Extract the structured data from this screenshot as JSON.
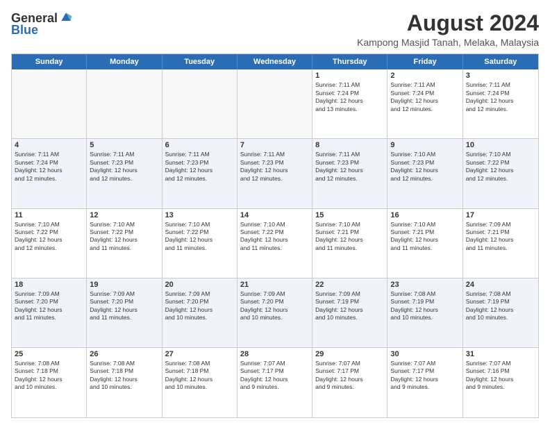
{
  "header": {
    "logo_general": "General",
    "logo_blue": "Blue",
    "month_year": "August 2024",
    "location": "Kampong Masjid Tanah, Melaka, Malaysia"
  },
  "days_of_week": [
    "Sunday",
    "Monday",
    "Tuesday",
    "Wednesday",
    "Thursday",
    "Friday",
    "Saturday"
  ],
  "weeks": [
    {
      "alt": false,
      "cells": [
        {
          "day": "",
          "info": ""
        },
        {
          "day": "",
          "info": ""
        },
        {
          "day": "",
          "info": ""
        },
        {
          "day": "",
          "info": ""
        },
        {
          "day": "1",
          "info": "Sunrise: 7:11 AM\nSunset: 7:24 PM\nDaylight: 12 hours\nand 13 minutes."
        },
        {
          "day": "2",
          "info": "Sunrise: 7:11 AM\nSunset: 7:24 PM\nDaylight: 12 hours\nand 12 minutes."
        },
        {
          "day": "3",
          "info": "Sunrise: 7:11 AM\nSunset: 7:24 PM\nDaylight: 12 hours\nand 12 minutes."
        }
      ]
    },
    {
      "alt": true,
      "cells": [
        {
          "day": "4",
          "info": "Sunrise: 7:11 AM\nSunset: 7:24 PM\nDaylight: 12 hours\nand 12 minutes."
        },
        {
          "day": "5",
          "info": "Sunrise: 7:11 AM\nSunset: 7:23 PM\nDaylight: 12 hours\nand 12 minutes."
        },
        {
          "day": "6",
          "info": "Sunrise: 7:11 AM\nSunset: 7:23 PM\nDaylight: 12 hours\nand 12 minutes."
        },
        {
          "day": "7",
          "info": "Sunrise: 7:11 AM\nSunset: 7:23 PM\nDaylight: 12 hours\nand 12 minutes."
        },
        {
          "day": "8",
          "info": "Sunrise: 7:11 AM\nSunset: 7:23 PM\nDaylight: 12 hours\nand 12 minutes."
        },
        {
          "day": "9",
          "info": "Sunrise: 7:10 AM\nSunset: 7:23 PM\nDaylight: 12 hours\nand 12 minutes."
        },
        {
          "day": "10",
          "info": "Sunrise: 7:10 AM\nSunset: 7:22 PM\nDaylight: 12 hours\nand 12 minutes."
        }
      ]
    },
    {
      "alt": false,
      "cells": [
        {
          "day": "11",
          "info": "Sunrise: 7:10 AM\nSunset: 7:22 PM\nDaylight: 12 hours\nand 12 minutes."
        },
        {
          "day": "12",
          "info": "Sunrise: 7:10 AM\nSunset: 7:22 PM\nDaylight: 12 hours\nand 11 minutes."
        },
        {
          "day": "13",
          "info": "Sunrise: 7:10 AM\nSunset: 7:22 PM\nDaylight: 12 hours\nand 11 minutes."
        },
        {
          "day": "14",
          "info": "Sunrise: 7:10 AM\nSunset: 7:22 PM\nDaylight: 12 hours\nand 11 minutes."
        },
        {
          "day": "15",
          "info": "Sunrise: 7:10 AM\nSunset: 7:21 PM\nDaylight: 12 hours\nand 11 minutes."
        },
        {
          "day": "16",
          "info": "Sunrise: 7:10 AM\nSunset: 7:21 PM\nDaylight: 12 hours\nand 11 minutes."
        },
        {
          "day": "17",
          "info": "Sunrise: 7:09 AM\nSunset: 7:21 PM\nDaylight: 12 hours\nand 11 minutes."
        }
      ]
    },
    {
      "alt": true,
      "cells": [
        {
          "day": "18",
          "info": "Sunrise: 7:09 AM\nSunset: 7:20 PM\nDaylight: 12 hours\nand 11 minutes."
        },
        {
          "day": "19",
          "info": "Sunrise: 7:09 AM\nSunset: 7:20 PM\nDaylight: 12 hours\nand 11 minutes."
        },
        {
          "day": "20",
          "info": "Sunrise: 7:09 AM\nSunset: 7:20 PM\nDaylight: 12 hours\nand 10 minutes."
        },
        {
          "day": "21",
          "info": "Sunrise: 7:09 AM\nSunset: 7:20 PM\nDaylight: 12 hours\nand 10 minutes."
        },
        {
          "day": "22",
          "info": "Sunrise: 7:09 AM\nSunset: 7:19 PM\nDaylight: 12 hours\nand 10 minutes."
        },
        {
          "day": "23",
          "info": "Sunrise: 7:08 AM\nSunset: 7:19 PM\nDaylight: 12 hours\nand 10 minutes."
        },
        {
          "day": "24",
          "info": "Sunrise: 7:08 AM\nSunset: 7:19 PM\nDaylight: 12 hours\nand 10 minutes."
        }
      ]
    },
    {
      "alt": false,
      "cells": [
        {
          "day": "25",
          "info": "Sunrise: 7:08 AM\nSunset: 7:18 PM\nDaylight: 12 hours\nand 10 minutes."
        },
        {
          "day": "26",
          "info": "Sunrise: 7:08 AM\nSunset: 7:18 PM\nDaylight: 12 hours\nand 10 minutes."
        },
        {
          "day": "27",
          "info": "Sunrise: 7:08 AM\nSunset: 7:18 PM\nDaylight: 12 hours\nand 10 minutes."
        },
        {
          "day": "28",
          "info": "Sunrise: 7:07 AM\nSunset: 7:17 PM\nDaylight: 12 hours\nand 9 minutes."
        },
        {
          "day": "29",
          "info": "Sunrise: 7:07 AM\nSunset: 7:17 PM\nDaylight: 12 hours\nand 9 minutes."
        },
        {
          "day": "30",
          "info": "Sunrise: 7:07 AM\nSunset: 7:17 PM\nDaylight: 12 hours\nand 9 minutes."
        },
        {
          "day": "31",
          "info": "Sunrise: 7:07 AM\nSunset: 7:16 PM\nDaylight: 12 hours\nand 9 minutes."
        }
      ]
    }
  ]
}
